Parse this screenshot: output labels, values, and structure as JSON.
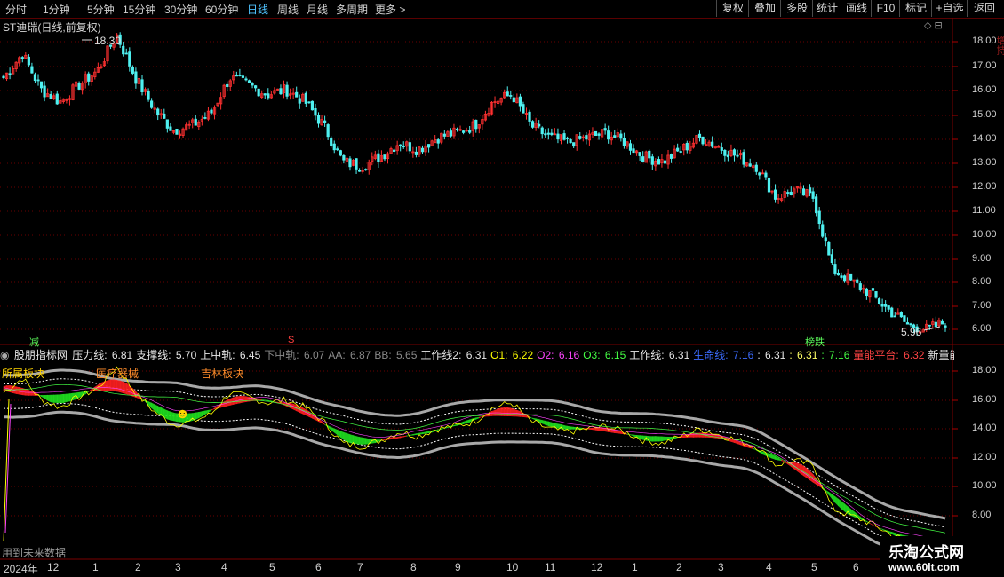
{
  "toolbar": {
    "periods": [
      "分时",
      "1分钟",
      "5分钟",
      "15分钟",
      "30分钟",
      "60分钟",
      "日线",
      "周线",
      "月线",
      "多周期",
      "更多 >"
    ],
    "active_period": "日线",
    "tools": [
      "复权",
      "叠加",
      "多股",
      "统计",
      "画线",
      "F10",
      "标记",
      "+自选",
      "返回"
    ]
  },
  "header": {
    "title": "ST迪瑞(日线,前复权)",
    "icons": "◇ ⊟"
  },
  "main_chart": {
    "y_ticks": [
      "18.00",
      "17.00",
      "16.00",
      "15.00",
      "14.00",
      "13.00",
      "12.00",
      "11.00",
      "10.00",
      "9.00",
      "8.00",
      "7.00",
      "6.00"
    ],
    "high_label": "18.30",
    "low_label": "5.96",
    "markers": {
      "left": "减",
      "mid": "S",
      "right": "榜跌"
    },
    "side_text": "增持"
  },
  "indicator": {
    "name": "股朋指标网",
    "values": [
      {
        "label": "压力线: ",
        "value": "6.81",
        "color": "#e8e8e8"
      },
      {
        "label": "支撑线: ",
        "value": "5.70",
        "color": "#e8e8e8"
      },
      {
        "label": "上中轨: ",
        "value": "6.45",
        "color": "#e8e8e8"
      },
      {
        "label": "下中轨: ",
        "value": "6.07",
        "color": "#8a8a8a"
      },
      {
        "label": "AA: ",
        "value": "6.87",
        "color": "#8a8a8a"
      },
      {
        "label": "BB: ",
        "value": "5.65",
        "color": "#8a8a8a"
      },
      {
        "label": "工作线2: ",
        "value": "6.31",
        "color": "#e8e8e8"
      },
      {
        "label": "O1: ",
        "value": "6.22",
        "color": "#ffff00"
      },
      {
        "label": "O2: ",
        "value": "6.16",
        "color": "#ff44ff"
      },
      {
        "label": "O3: ",
        "value": "6.15",
        "color": "#44ff44"
      },
      {
        "label": "工作线: ",
        "value": "6.31",
        "color": "#e8e8e8"
      },
      {
        "label": "生命线: ",
        "value": "7.16",
        "color": "#3c6cff"
      },
      {
        "label": ": ",
        "value": "6.31",
        "color": "#e8e8e8"
      },
      {
        "label": ": ",
        "value": "6.31",
        "color": "#ffff66"
      },
      {
        "label": ": ",
        "value": "7.16",
        "color": "#44ff44"
      },
      {
        "label": "量能平台: ",
        "value": "6.32",
        "color": "#ff4444"
      },
      {
        "label": "新量能点",
        "value": "",
        "color": "#e8e8e8"
      }
    ],
    "y_ticks": [
      "18.00",
      "16.00",
      "14.00",
      "12.00",
      "10.00",
      "8.00"
    ],
    "tags": [
      {
        "text": "医疗器械",
        "color": "#ff8c2a"
      },
      {
        "text": "吉林板块",
        "color": "#ff8c2a"
      },
      {
        "text": "所属板块",
        "color": "#ffd400"
      }
    ],
    "footer_note": "用到未来数据",
    "smiley": "☻"
  },
  "x_axis": {
    "dates": [
      "2024年",
      "12",
      "1",
      "2",
      "3",
      "4",
      "5",
      "6",
      "7",
      "8",
      "9",
      "10",
      "11",
      "12",
      "1",
      "2",
      "3",
      "4",
      "5",
      "6"
    ]
  },
  "watermark": {
    "line1": "乐淘公式网",
    "line2": "www.60lt.com"
  },
  "chart_data": {
    "type": "line",
    "title": "ST迪瑞(日线,前复权)",
    "price_range": [
      5.96,
      18.3
    ],
    "ylim_main": [
      5.6,
      18.8
    ],
    "ylim_indicator": [
      7.2,
      19.2
    ],
    "close_approx": [
      16.5,
      17.5,
      16.0,
      15.5,
      16.2,
      16.8,
      18.3,
      16.5,
      15.2,
      14.3,
      14.5,
      15.0,
      16.5,
      16.2,
      15.8,
      16.0,
      15.5,
      14.5,
      13.0,
      12.8,
      13.2,
      13.8,
      13.5,
      14.0,
      14.2,
      14.5,
      15.5,
      15.8,
      14.5,
      14.0,
      13.8,
      14.0,
      14.2,
      13.8,
      13.2,
      13.0,
      13.5,
      14.0,
      13.6,
      13.2,
      12.8,
      11.5,
      11.8,
      11.5,
      8.5,
      8.0,
      7.5,
      6.8,
      6.2,
      6.0,
      6.3
    ]
  }
}
